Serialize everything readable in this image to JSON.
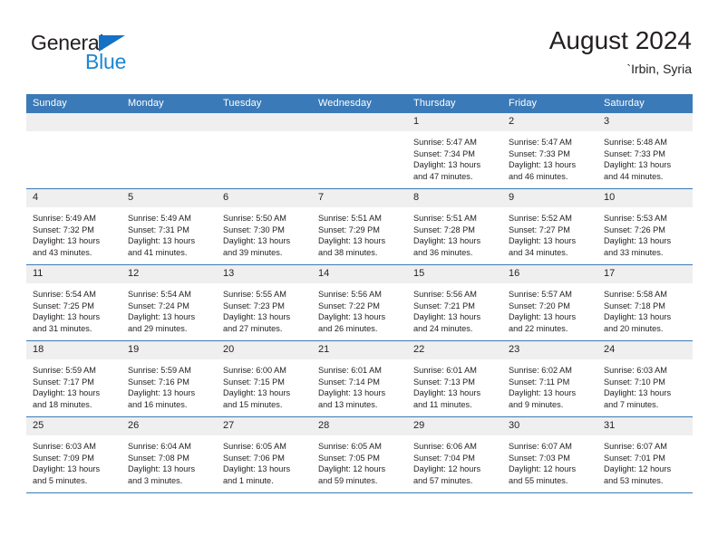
{
  "brand": {
    "name_dark": "General",
    "name_blue": "Blue",
    "logo_icon": "blue-triangle-icon",
    "dark_color": "#231f20",
    "blue_color": "#1b87d4",
    "triangle_color": "#1471c4"
  },
  "header": {
    "title": "August 2024",
    "location": "`Irbin, Syria"
  },
  "theme": {
    "header_blue": "#3b7ab8",
    "daynum_gray": "#efefef",
    "text": "#231f20",
    "row_rule": "#3b7ab8"
  },
  "calendar": {
    "weekday_headers": [
      "Sunday",
      "Monday",
      "Tuesday",
      "Wednesday",
      "Thursday",
      "Friday",
      "Saturday"
    ],
    "weeks": [
      [
        {
          "day": "",
          "empty": true
        },
        {
          "day": "",
          "empty": true
        },
        {
          "day": "",
          "empty": true
        },
        {
          "day": "",
          "empty": true
        },
        {
          "day": "1",
          "sunrise": "Sunrise: 5:47 AM",
          "sunset": "Sunset: 7:34 PM",
          "daylight1": "Daylight: 13 hours",
          "daylight2": "and 47 minutes."
        },
        {
          "day": "2",
          "sunrise": "Sunrise: 5:47 AM",
          "sunset": "Sunset: 7:33 PM",
          "daylight1": "Daylight: 13 hours",
          "daylight2": "and 46 minutes."
        },
        {
          "day": "3",
          "sunrise": "Sunrise: 5:48 AM",
          "sunset": "Sunset: 7:33 PM",
          "daylight1": "Daylight: 13 hours",
          "daylight2": "and 44 minutes."
        }
      ],
      [
        {
          "day": "4",
          "sunrise": "Sunrise: 5:49 AM",
          "sunset": "Sunset: 7:32 PM",
          "daylight1": "Daylight: 13 hours",
          "daylight2": "and 43 minutes."
        },
        {
          "day": "5",
          "sunrise": "Sunrise: 5:49 AM",
          "sunset": "Sunset: 7:31 PM",
          "daylight1": "Daylight: 13 hours",
          "daylight2": "and 41 minutes."
        },
        {
          "day": "6",
          "sunrise": "Sunrise: 5:50 AM",
          "sunset": "Sunset: 7:30 PM",
          "daylight1": "Daylight: 13 hours",
          "daylight2": "and 39 minutes."
        },
        {
          "day": "7",
          "sunrise": "Sunrise: 5:51 AM",
          "sunset": "Sunset: 7:29 PM",
          "daylight1": "Daylight: 13 hours",
          "daylight2": "and 38 minutes."
        },
        {
          "day": "8",
          "sunrise": "Sunrise: 5:51 AM",
          "sunset": "Sunset: 7:28 PM",
          "daylight1": "Daylight: 13 hours",
          "daylight2": "and 36 minutes."
        },
        {
          "day": "9",
          "sunrise": "Sunrise: 5:52 AM",
          "sunset": "Sunset: 7:27 PM",
          "daylight1": "Daylight: 13 hours",
          "daylight2": "and 34 minutes."
        },
        {
          "day": "10",
          "sunrise": "Sunrise: 5:53 AM",
          "sunset": "Sunset: 7:26 PM",
          "daylight1": "Daylight: 13 hours",
          "daylight2": "and 33 minutes."
        }
      ],
      [
        {
          "day": "11",
          "sunrise": "Sunrise: 5:54 AM",
          "sunset": "Sunset: 7:25 PM",
          "daylight1": "Daylight: 13 hours",
          "daylight2": "and 31 minutes."
        },
        {
          "day": "12",
          "sunrise": "Sunrise: 5:54 AM",
          "sunset": "Sunset: 7:24 PM",
          "daylight1": "Daylight: 13 hours",
          "daylight2": "and 29 minutes."
        },
        {
          "day": "13",
          "sunrise": "Sunrise: 5:55 AM",
          "sunset": "Sunset: 7:23 PM",
          "daylight1": "Daylight: 13 hours",
          "daylight2": "and 27 minutes."
        },
        {
          "day": "14",
          "sunrise": "Sunrise: 5:56 AM",
          "sunset": "Sunset: 7:22 PM",
          "daylight1": "Daylight: 13 hours",
          "daylight2": "and 26 minutes."
        },
        {
          "day": "15",
          "sunrise": "Sunrise: 5:56 AM",
          "sunset": "Sunset: 7:21 PM",
          "daylight1": "Daylight: 13 hours",
          "daylight2": "and 24 minutes."
        },
        {
          "day": "16",
          "sunrise": "Sunrise: 5:57 AM",
          "sunset": "Sunset: 7:20 PM",
          "daylight1": "Daylight: 13 hours",
          "daylight2": "and 22 minutes."
        },
        {
          "day": "17",
          "sunrise": "Sunrise: 5:58 AM",
          "sunset": "Sunset: 7:18 PM",
          "daylight1": "Daylight: 13 hours",
          "daylight2": "and 20 minutes."
        }
      ],
      [
        {
          "day": "18",
          "sunrise": "Sunrise: 5:59 AM",
          "sunset": "Sunset: 7:17 PM",
          "daylight1": "Daylight: 13 hours",
          "daylight2": "and 18 minutes."
        },
        {
          "day": "19",
          "sunrise": "Sunrise: 5:59 AM",
          "sunset": "Sunset: 7:16 PM",
          "daylight1": "Daylight: 13 hours",
          "daylight2": "and 16 minutes."
        },
        {
          "day": "20",
          "sunrise": "Sunrise: 6:00 AM",
          "sunset": "Sunset: 7:15 PM",
          "daylight1": "Daylight: 13 hours",
          "daylight2": "and 15 minutes."
        },
        {
          "day": "21",
          "sunrise": "Sunrise: 6:01 AM",
          "sunset": "Sunset: 7:14 PM",
          "daylight1": "Daylight: 13 hours",
          "daylight2": "and 13 minutes."
        },
        {
          "day": "22",
          "sunrise": "Sunrise: 6:01 AM",
          "sunset": "Sunset: 7:13 PM",
          "daylight1": "Daylight: 13 hours",
          "daylight2": "and 11 minutes."
        },
        {
          "day": "23",
          "sunrise": "Sunrise: 6:02 AM",
          "sunset": "Sunset: 7:11 PM",
          "daylight1": "Daylight: 13 hours",
          "daylight2": "and 9 minutes."
        },
        {
          "day": "24",
          "sunrise": "Sunrise: 6:03 AM",
          "sunset": "Sunset: 7:10 PM",
          "daylight1": "Daylight: 13 hours",
          "daylight2": "and 7 minutes."
        }
      ],
      [
        {
          "day": "25",
          "sunrise": "Sunrise: 6:03 AM",
          "sunset": "Sunset: 7:09 PM",
          "daylight1": "Daylight: 13 hours",
          "daylight2": "and 5 minutes."
        },
        {
          "day": "26",
          "sunrise": "Sunrise: 6:04 AM",
          "sunset": "Sunset: 7:08 PM",
          "daylight1": "Daylight: 13 hours",
          "daylight2": "and 3 minutes."
        },
        {
          "day": "27",
          "sunrise": "Sunrise: 6:05 AM",
          "sunset": "Sunset: 7:06 PM",
          "daylight1": "Daylight: 13 hours",
          "daylight2": "and 1 minute."
        },
        {
          "day": "28",
          "sunrise": "Sunrise: 6:05 AM",
          "sunset": "Sunset: 7:05 PM",
          "daylight1": "Daylight: 12 hours",
          "daylight2": "and 59 minutes."
        },
        {
          "day": "29",
          "sunrise": "Sunrise: 6:06 AM",
          "sunset": "Sunset: 7:04 PM",
          "daylight1": "Daylight: 12 hours",
          "daylight2": "and 57 minutes."
        },
        {
          "day": "30",
          "sunrise": "Sunrise: 6:07 AM",
          "sunset": "Sunset: 7:03 PM",
          "daylight1": "Daylight: 12 hours",
          "daylight2": "and 55 minutes."
        },
        {
          "day": "31",
          "sunrise": "Sunrise: 6:07 AM",
          "sunset": "Sunset: 7:01 PM",
          "daylight1": "Daylight: 12 hours",
          "daylight2": "and 53 minutes."
        }
      ]
    ]
  }
}
